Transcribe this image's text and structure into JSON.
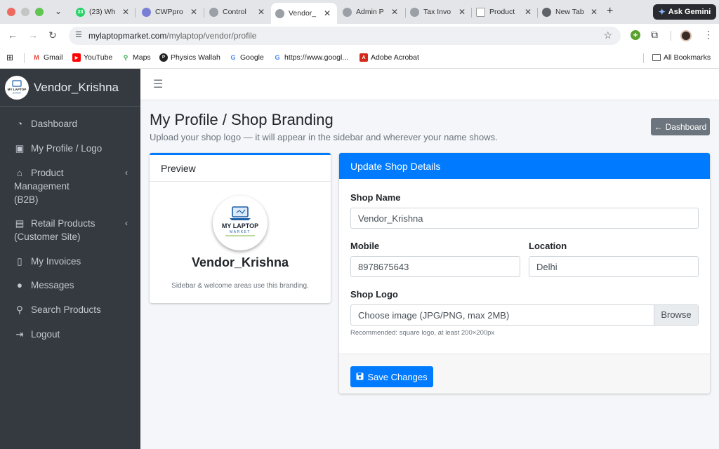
{
  "browser": {
    "tabs": [
      {
        "title": "(23) Wh",
        "badge": "23",
        "favicon": "whatsapp-icon"
      },
      {
        "title": "CWPpro",
        "favicon": "cwp-icon"
      },
      {
        "title": "Control",
        "favicon": "globe-icon"
      },
      {
        "title": "Vendor_",
        "favicon": "globe-icon",
        "active": true
      },
      {
        "title": "Admin P",
        "favicon": "globe-icon"
      },
      {
        "title": "Tax Invo",
        "favicon": "globe-icon"
      },
      {
        "title": "Product",
        "favicon": "document-icon"
      },
      {
        "title": "New Tab",
        "favicon": "chrome-icon"
      }
    ],
    "ask_gemini": "Ask Gemini",
    "url_host": "mylaptopmarket.com",
    "url_path": "/mylaptop/vendor/profile",
    "bookmarks": [
      {
        "label": "Gmail",
        "icon": "gmail-icon",
        "color": "#ea4335"
      },
      {
        "label": "YouTube",
        "icon": "youtube-icon",
        "color": "#ff0000"
      },
      {
        "label": "Maps",
        "icon": "maps-icon",
        "color": "#34a853"
      },
      {
        "label": "Physics Wallah",
        "icon": "pw-icon",
        "color": "#222222"
      },
      {
        "label": "Google",
        "icon": "google-icon",
        "color": "#4285f4"
      },
      {
        "label": "https://www.googl...",
        "icon": "google-icon",
        "color": "#4285f4"
      },
      {
        "label": "Adobe Acrobat",
        "icon": "acrobat-icon",
        "color": "#d4281b"
      }
    ],
    "all_bookmarks": "All Bookmarks"
  },
  "sidebar": {
    "brand": "Vendor_Krishna",
    "items": [
      {
        "label": "Dashboard",
        "icon": "tachometer-icon"
      },
      {
        "label": "My Profile / Logo",
        "icon": "id-badge-icon"
      },
      {
        "label": "Product Management",
        "label2": "(B2B)",
        "icon": "store-icon",
        "chevron": true
      },
      {
        "label": "Retail Products",
        "label2": "(Customer Site)",
        "icon": "shopping-bag-icon",
        "chevron": true
      },
      {
        "label": "My Invoices",
        "icon": "invoice-icon"
      },
      {
        "label": "Messages",
        "icon": "comments-icon"
      },
      {
        "label": "Search Products",
        "icon": "search-icon"
      },
      {
        "label": "Logout",
        "icon": "sign-out-icon"
      }
    ]
  },
  "page": {
    "title": "My Profile / Shop Branding",
    "subtitle": "Upload your shop logo — it will appear in the sidebar and wherever your name shows.",
    "dashboard_button": "Dashboard"
  },
  "preview": {
    "header": "Preview",
    "logo_text_1": "MY LAPTOP",
    "logo_text_2": "MARKET",
    "name": "Vendor_Krishna",
    "note": "Sidebar & welcome areas use this branding."
  },
  "form": {
    "header": "Update Shop Details",
    "shop_name_label": "Shop Name",
    "shop_name_value": "Vendor_Krishna",
    "mobile_label": "Mobile",
    "mobile_value": "8978675643",
    "location_label": "Location",
    "location_value": "Delhi",
    "logo_label": "Shop Logo",
    "logo_placeholder": "Choose image (JPG/PNG, max 2MB)",
    "browse": "Browse",
    "hint": "Recommended: square logo, at least 200×200px",
    "save": "Save Changes"
  },
  "colors": {
    "primary": "#007bff",
    "sidebar_bg": "#343a40",
    "secondary_btn": "#6c757d"
  }
}
